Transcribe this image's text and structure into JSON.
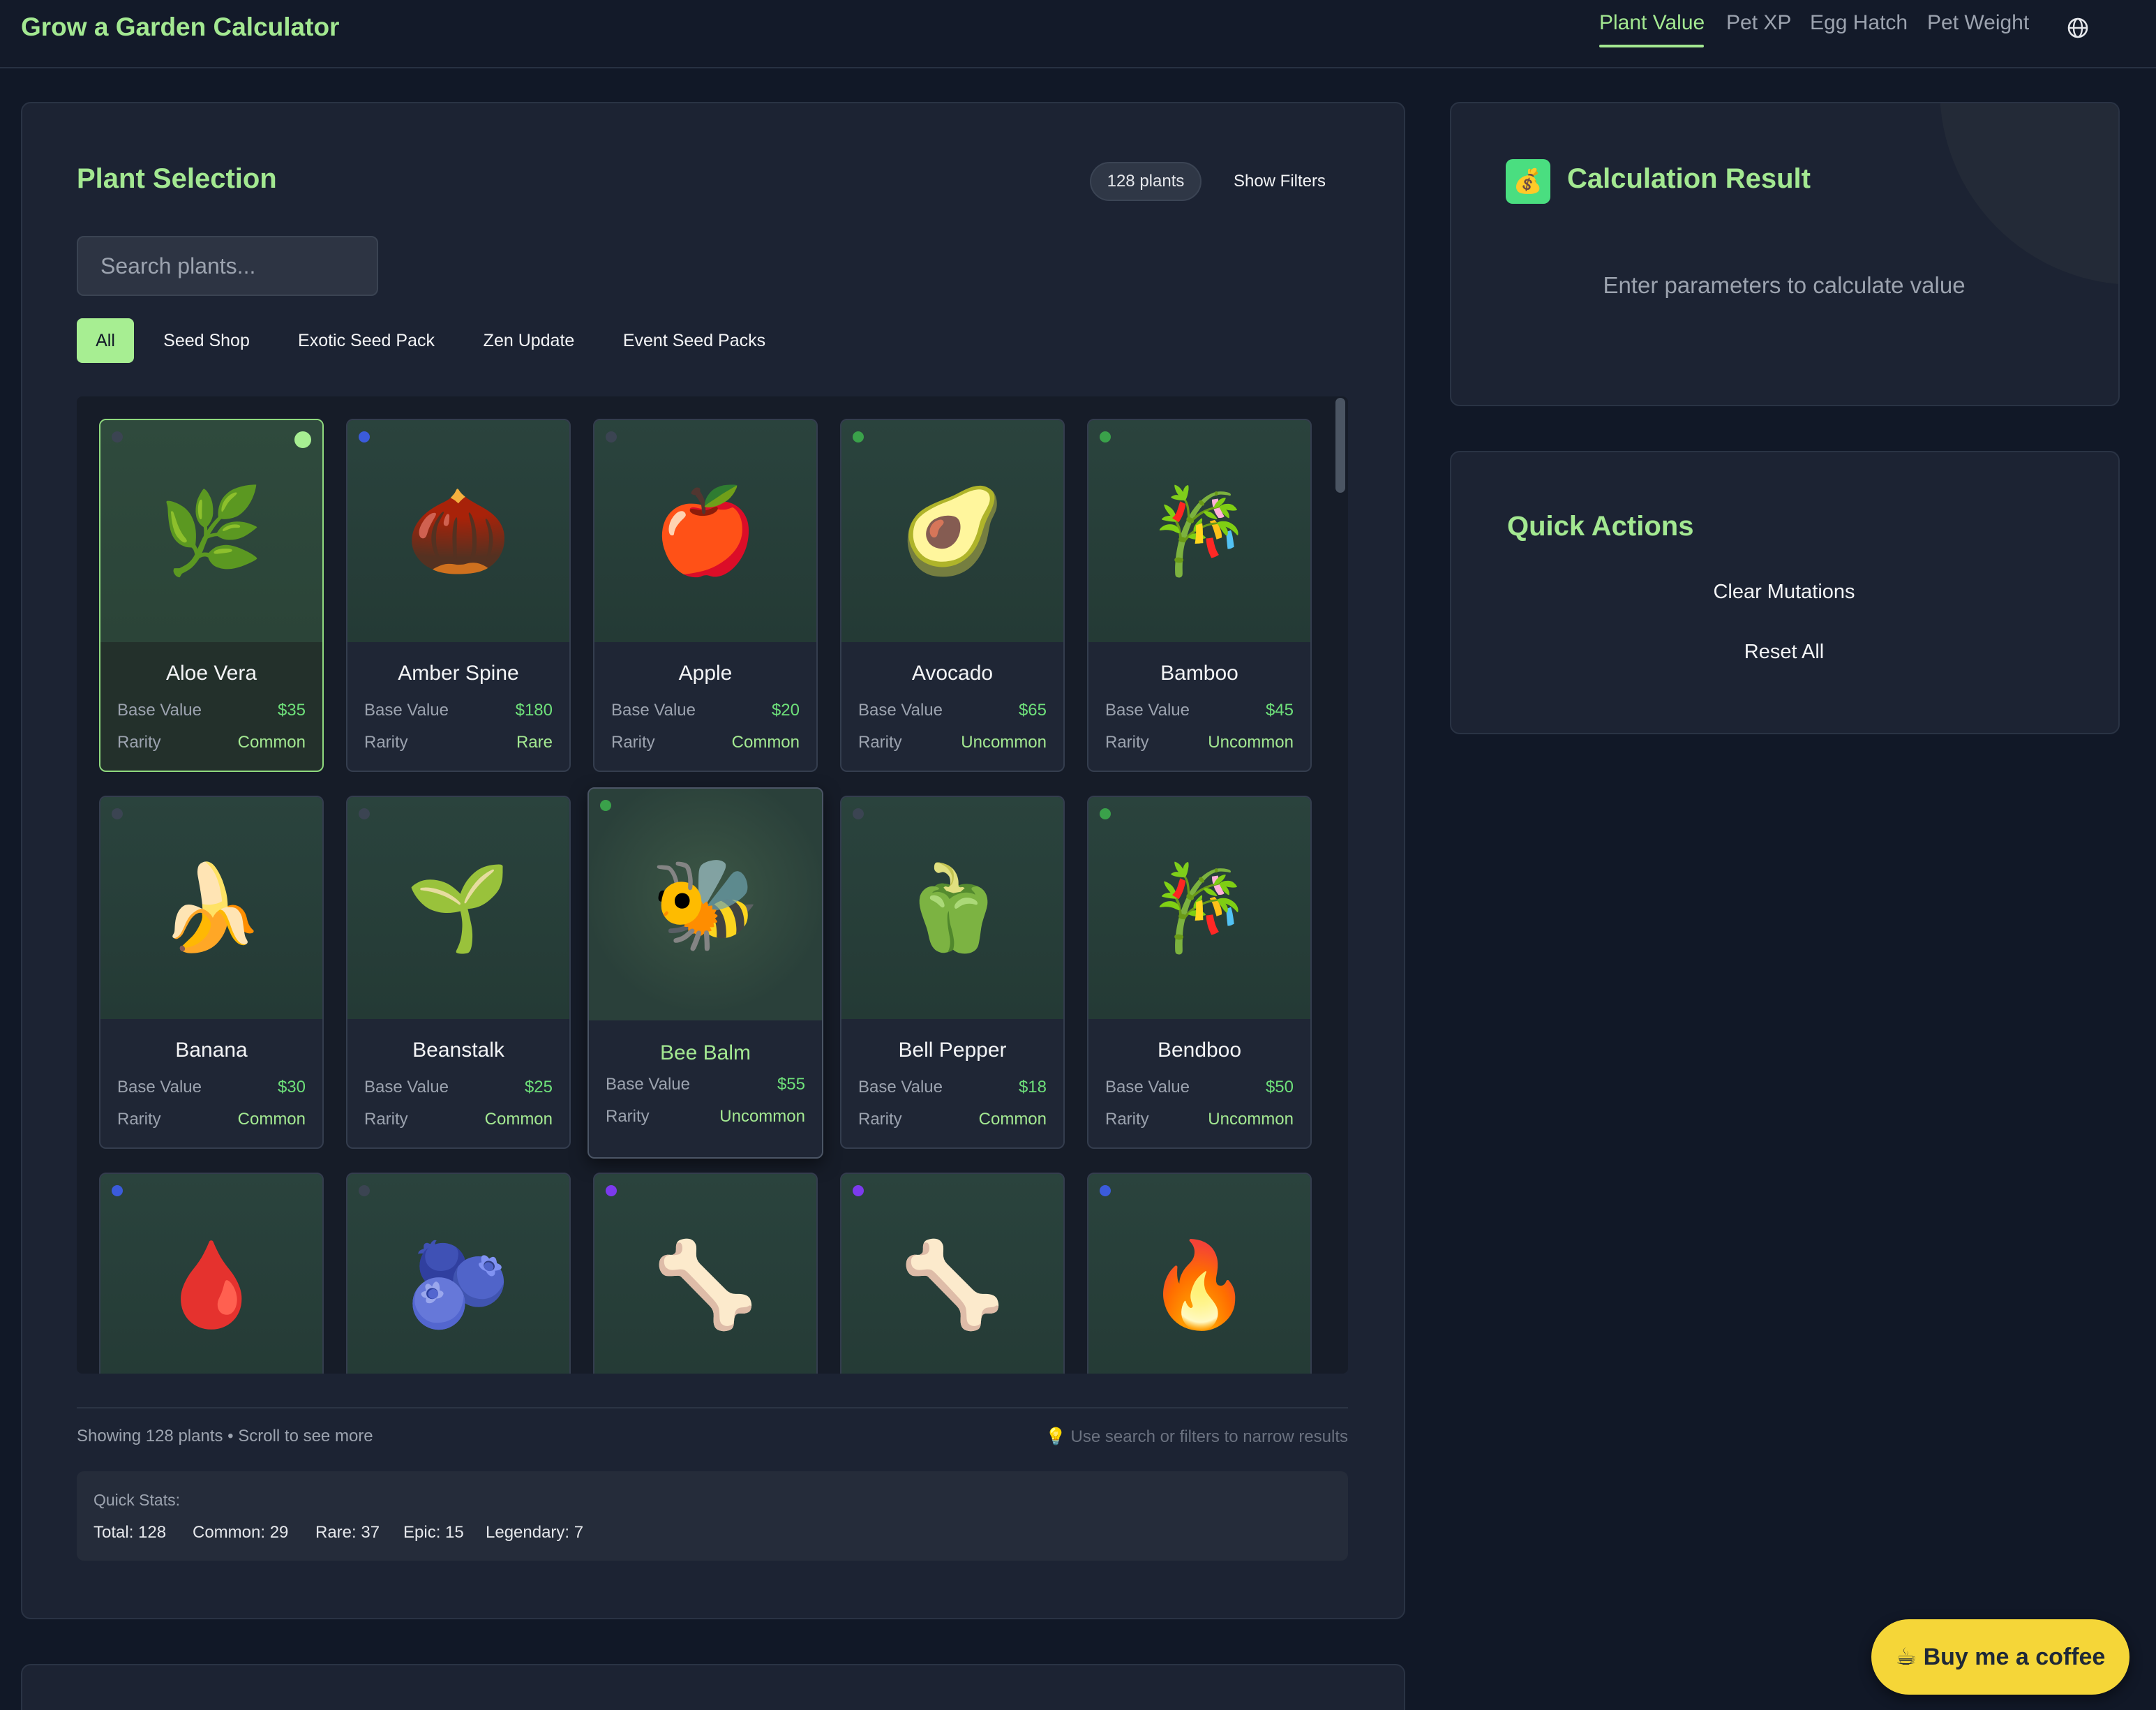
{
  "app": {
    "title": "Grow a Garden Calculator",
    "nav": [
      {
        "label": "Plant Value",
        "active": true
      },
      {
        "label": "Pet XP",
        "active": false
      },
      {
        "label": "Egg Hatch",
        "active": false
      },
      {
        "label": "Pet Weight",
        "active": false
      }
    ],
    "language_icon": "globe-icon"
  },
  "plant_selection": {
    "title": "Plant Selection",
    "count_badge": "128 plants",
    "show_filters_label": "Show Filters",
    "search": {
      "placeholder": "Search plants...",
      "value": ""
    },
    "filters": [
      {
        "label": "All",
        "active": true
      },
      {
        "label": "Seed Shop",
        "active": false
      },
      {
        "label": "Exotic Seed Pack",
        "active": false
      },
      {
        "label": "Zen Update",
        "active": false
      },
      {
        "label": "Event Seed Packs",
        "active": false
      }
    ],
    "labels": {
      "base_value": "Base Value",
      "rarity": "Rarity"
    },
    "plants": [
      {
        "name": "Aloe Vera",
        "icon": "🌿",
        "value": "$35",
        "rarity": "Common",
        "dot": "#3b4452",
        "selected": true
      },
      {
        "name": "Amber Spine",
        "icon": "🌰",
        "value": "$180",
        "rarity": "Rare",
        "dot": "#3b5bdb"
      },
      {
        "name": "Apple",
        "icon": "🍎",
        "value": "$20",
        "rarity": "Common",
        "dot": "#3b4452"
      },
      {
        "name": "Avocado",
        "icon": "🥑",
        "value": "$65",
        "rarity": "Uncommon",
        "dot": "#3aa14a"
      },
      {
        "name": "Bamboo",
        "icon": "🎋",
        "value": "$45",
        "rarity": "Uncommon",
        "dot": "#3aa14a"
      },
      {
        "name": "Banana",
        "icon": "🍌",
        "value": "$30",
        "rarity": "Common",
        "dot": "#3b4452"
      },
      {
        "name": "Beanstalk",
        "icon": "🌱",
        "value": "$25",
        "rarity": "Common",
        "dot": "#3b4452"
      },
      {
        "name": "Bee Balm",
        "icon": "🐝",
        "value": "$55",
        "rarity": "Uncommon",
        "dot": "#3aa14a",
        "hover": true
      },
      {
        "name": "Bell Pepper",
        "icon": "🫑",
        "value": "$18",
        "rarity": "Common",
        "dot": "#3b4452"
      },
      {
        "name": "Bendboo",
        "icon": "🎋",
        "value": "$50",
        "rarity": "Uncommon",
        "dot": "#3aa14a"
      },
      {
        "name": "",
        "icon": "🩸",
        "value": "",
        "rarity": "",
        "dot": "#3b5bdb"
      },
      {
        "name": "",
        "icon": "🫐",
        "value": "",
        "rarity": "",
        "dot": "#3b4452"
      },
      {
        "name": "",
        "icon": "🦴",
        "value": "",
        "rarity": "",
        "dot": "#7c3aed"
      },
      {
        "name": "",
        "icon": "🦴",
        "value": "",
        "rarity": "",
        "dot": "#7c3aed"
      },
      {
        "name": "",
        "icon": "🔥",
        "value": "",
        "rarity": "",
        "dot": "#3b5bdb"
      }
    ],
    "footer_left": "Showing 128 plants • Scroll to see more",
    "footer_right": "💡 Use search or filters to narrow results",
    "quick_stats": {
      "label": "Quick Stats:",
      "items": [
        "Total: 128",
        "Common: 29",
        "Rare: 37",
        "Epic: 15",
        "Legendary: 7"
      ]
    }
  },
  "calculation": {
    "title": "Calculation Result",
    "icon": "💰",
    "hint": "Enter parameters to calculate value"
  },
  "quick_actions": {
    "title": "Quick Actions",
    "clear_label": "Clear Mutations",
    "reset_label": "Reset All"
  },
  "coffee_button": "☕  Buy me a coffee",
  "colors": {
    "accent": "#a3e891",
    "price": "#6ee07a",
    "background": "#111827",
    "panel": "#1c2333",
    "coffee": "#f5d638"
  }
}
